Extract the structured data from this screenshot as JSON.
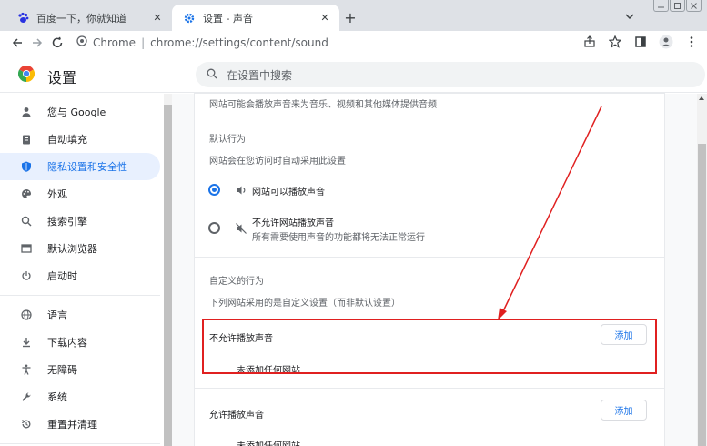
{
  "tabs": [
    {
      "title": "百度一下，你就知道",
      "close": "✕"
    },
    {
      "title": "设置 - 声音",
      "close": "✕"
    }
  ],
  "new_tab": "+",
  "omnibox": {
    "label": "Chrome",
    "separator": "|",
    "url": "chrome://settings/content/sound"
  },
  "settings": {
    "title": "设置",
    "search_placeholder": "在设置中搜索"
  },
  "sidebar": {
    "items": [
      {
        "label": "您与 Google",
        "icon": "person-icon"
      },
      {
        "label": "自动填充",
        "icon": "clipboard-icon"
      },
      {
        "label": "隐私设置和安全性",
        "icon": "shield-icon",
        "active": true
      },
      {
        "label": "外观",
        "icon": "palette-icon"
      },
      {
        "label": "搜索引擎",
        "icon": "search-icon"
      },
      {
        "label": "默认浏览器",
        "icon": "browser-icon"
      },
      {
        "label": "启动时",
        "icon": "power-icon"
      },
      {
        "label": "语言",
        "icon": "globe-icon"
      },
      {
        "label": "下载内容",
        "icon": "download-icon"
      },
      {
        "label": "无障碍",
        "icon": "accessibility-icon"
      },
      {
        "label": "系统",
        "icon": "wrench-icon"
      },
      {
        "label": "重置并清理",
        "icon": "reset-icon"
      }
    ]
  },
  "content": {
    "intro": "网站可能会播放声音来为音乐、视频和其他媒体提供音频",
    "default_behavior_heading": "默认行为",
    "default_behavior_desc": "网站会在您访问时自动采用此设置",
    "option_allow": "网站可以播放声音",
    "option_block": "不允许网站播放声音",
    "option_block_desc": "所有需要使用声音的功能都将无法正常运行",
    "custom_heading": "自定义的行为",
    "custom_desc": "下列网站采用的是自定义设置（而非默认设置）",
    "block_section_title": "不允许播放声音",
    "block_add_label": "添加",
    "block_empty": "未添加任何网站",
    "allow_section_title": "允许播放声音",
    "allow_add_label": "添加",
    "allow_empty": "未添加任何网站"
  },
  "annotation_color": "#e02020",
  "accent_color": "#1a73e8"
}
